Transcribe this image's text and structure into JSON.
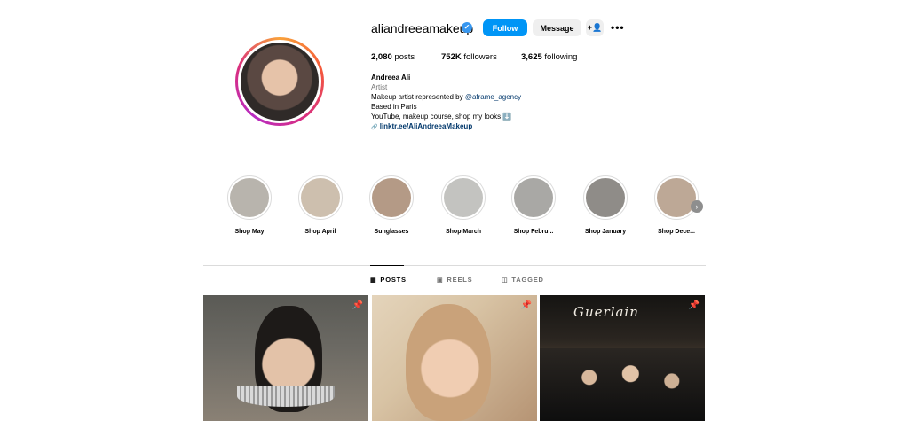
{
  "profile": {
    "username": "aliandreeamakeup",
    "verified_mark": "✔",
    "follow_label": "Follow",
    "message_label": "Message",
    "add_user_icon": "+👤",
    "more_icon": "•••"
  },
  "stats": {
    "posts": "2,080",
    "posts_label": "posts",
    "followers": "752K",
    "followers_label": "followers",
    "following": "3,625",
    "following_label": "following"
  },
  "bio": {
    "name": "Andreea Ali",
    "category": "Artist",
    "line1_prefix": "Makeup artist represented by ",
    "line1_mention": "@aframe_agency",
    "line2": "Based in Paris",
    "line3": "YouTube, makeup course, shop my looks ⬇️",
    "link_icon": "🔗",
    "link": "linktr.ee/AliAndreeaMakeup"
  },
  "highlights": [
    {
      "label": "Shop May",
      "color": "#b8b4ad"
    },
    {
      "label": "Shop April",
      "color": "#cdbfae"
    },
    {
      "label": "Sunglasses",
      "color": "#b49a86"
    },
    {
      "label": "Shop March",
      "color": "#c3c3c0"
    },
    {
      "label": "Shop Febru...",
      "color": "#a9a8a5"
    },
    {
      "label": "Shop January",
      "color": "#8f8c88"
    },
    {
      "label": "Shop Dece...",
      "color": "#bda896"
    }
  ],
  "highlights_next_icon": "›",
  "tabs": [
    {
      "label": "POSTS",
      "icon": "▦",
      "active": true
    },
    {
      "label": "REELS",
      "icon": "▣",
      "active": false
    },
    {
      "label": "TAGGED",
      "icon": "◫",
      "active": false
    }
  ],
  "posts": {
    "pin_icon": "📌",
    "sign_text": "Guerlain"
  }
}
